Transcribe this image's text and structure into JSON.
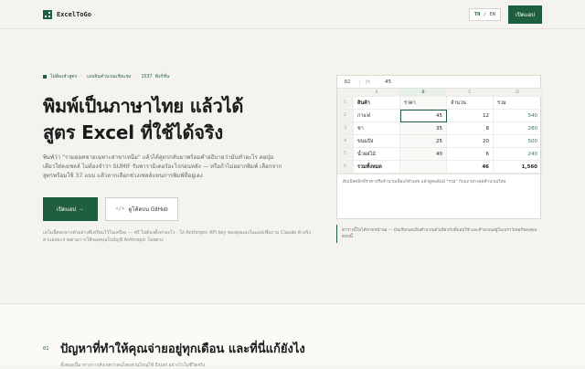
{
  "header": {
    "brand": "ExcelToGo",
    "lang_th": "TH",
    "lang_sep": " / ",
    "lang_en": "EN",
    "open_app": "เปิดแอป"
  },
  "hero": {
    "meta_1": "ไม่ต้องจำสูตร",
    "meta_2": "เอนจินคำนวณเชิงแชง",
    "meta_3": "1537 ฟังก์ชั่น",
    "title_line1": "พิมพ์เป็นภาษาไทย แล้วได้",
    "title_line2": "สูตร Excel ที่ใช้ได้จริง",
    "description": "พิมพ์ว่า \"รวมยอดขายเฉพาะสาขาเหนือ\" แล้วได้สูตรกลับมาพร้อมคำอธิบายว่ามันทำอะไร ตอปุ่มเดียวใส่ลงเซลล์ ไม่ต้องจำว่า SUMIF รับพารามิเตอร์อะไรก่อนหลัง — หรือถ้าไม่อยากพิมพ์ เลือกจากสูตรพร้อมใช้ 37 แบบ แล้วลากเลือกช่วงเซลล์แทนการพิมพ์ที่อยู่เอง",
    "cta_primary": "เปิดแอป",
    "cta_arrow": "→",
    "cta_code": "</>",
    "cta_secondary": "ดูโค้ดบน GitHub",
    "foot_note": "เดโมนี้ตอบจากตัวอย่างที่เตรียมไว้ในเครื่อง — ฟรี ไม่ต้องตั้งค่าอะไร · ใส่ Anthropic API key ของคุณเองในแอปเพื่อถาม Claude ตัวจริง ค่าแอปจะจ่ายตามการใช้ของคุณในบัญชี Anthropic โดยตรง"
  },
  "sheet": {
    "cell_ref": "B2",
    "fx": "fx",
    "formula_value": "45",
    "columns": [
      "A",
      "B",
      "C",
      "D"
    ],
    "rows": [
      {
        "n": "1",
        "a": "สินค้า",
        "b": "ราคา",
        "c": "จำนวน",
        "d": "รวม"
      },
      {
        "n": "2",
        "a": "กาแฟ",
        "b": "45",
        "c": "12",
        "d": "540"
      },
      {
        "n": "3",
        "a": "ชา",
        "b": "35",
        "c": "8",
        "d": "280"
      },
      {
        "n": "4",
        "a": "ขนมปัง",
        "b": "25",
        "c": "20",
        "d": "500"
      },
      {
        "n": "5",
        "a": "น้ำผลไม้",
        "b": "40",
        "c": "6",
        "d": "240"
      },
      {
        "n": "6",
        "a": "รวมทั้งหมด",
        "b": "",
        "c": "46",
        "d": "1,560"
      }
    ],
    "note": "ดับเบิลคลิกที่ราคาหรือจำนวนเพื่อแก้ตัวเลข แล้วดูคอลัมน์ \"รวม\" กับแถวล่างสุดคำนวณใหม่",
    "side_note": "ตารางนี้ไม่ได้ทาดหน้าจอ — มันเรียกเอนจินคำนวณตัวเดียวกับที่แอปใช้ และคำนวณอยู่ในเบราว์เซอร์ของคุณตอนนี้"
  },
  "section": {
    "number": "01",
    "title": "ปัญหาที่ทำให้คุณจ่ายอยู่ทุกเดือน และที่นี่แก้ยังไง",
    "subtitle": "ทั้งหมดนี้มาจากการสังเกตว่าคนไทยส่วนใหญ่ใช้ Excel อย่างไรในชีวิตจริง"
  }
}
